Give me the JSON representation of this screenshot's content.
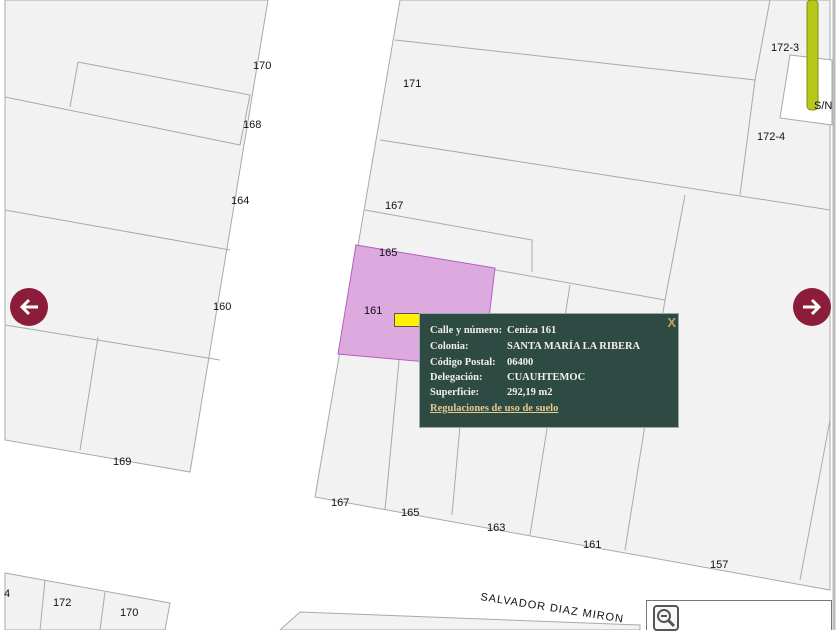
{
  "map": {
    "lot_labels": [
      {
        "id": "170-left",
        "text": "170"
      },
      {
        "id": "168",
        "text": "168"
      },
      {
        "id": "164",
        "text": "164"
      },
      {
        "id": "160",
        "text": "160"
      },
      {
        "id": "169",
        "text": "169"
      },
      {
        "id": "171",
        "text": "171"
      },
      {
        "id": "167",
        "text": "167"
      },
      {
        "id": "165",
        "text": "165"
      },
      {
        "id": "161",
        "text": "161"
      },
      {
        "id": "172-3",
        "text": "172-3"
      },
      {
        "id": "172-4",
        "text": "172-4"
      },
      {
        "id": "167-bottom",
        "text": "167"
      },
      {
        "id": "165-bottom",
        "text": "165"
      },
      {
        "id": "163-bottom",
        "text": "163"
      },
      {
        "id": "161-bottom",
        "text": "161"
      },
      {
        "id": "157-bottom",
        "text": "157"
      },
      {
        "id": "4",
        "text": "4"
      },
      {
        "id": "172-bottom",
        "text": "172"
      },
      {
        "id": "170-bottom",
        "text": "170"
      },
      {
        "id": "s-n",
        "text": "S/N"
      }
    ],
    "street_name": "SALVADOR DIAZ MIRON",
    "selected_lot_color": "#dcaadf",
    "nav_color": "#8b1c3a"
  },
  "popup": {
    "rows": [
      {
        "label": "Calle y número:",
        "value": "Ceniza 161"
      },
      {
        "label": "Colonia:",
        "value": "SANTA MARÍA LA RIBERA"
      },
      {
        "label": "Código Postal:",
        "value": "06400"
      },
      {
        "label": "Delegación:",
        "value": "CUAUHTEMOC"
      },
      {
        "label": "Superficie:",
        "value": "292,19 m2"
      }
    ],
    "link": "Regulaciones de uso de suelo",
    "close": "X",
    "background": "#2d4a43"
  },
  "controls": {
    "prev_icon": "arrow-left",
    "next_icon": "arrow-right",
    "zoom_out_icon": "magnifier-minus"
  }
}
